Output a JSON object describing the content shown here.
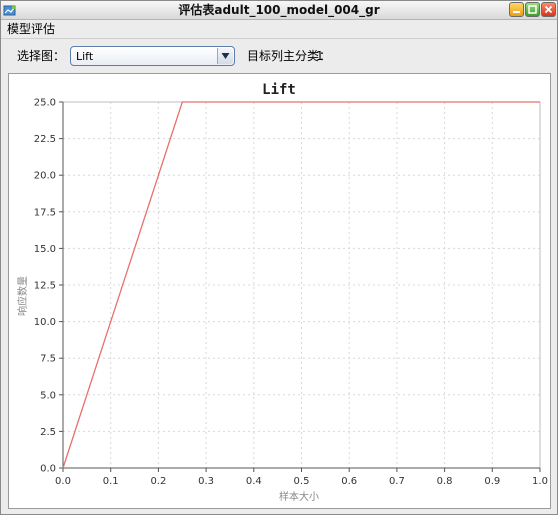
{
  "window": {
    "title": "评估表adult_100_model_004_gr",
    "icons": [
      "app-icon",
      "minimize-icon",
      "maximize-icon",
      "close-icon"
    ]
  },
  "menubar": {
    "items": [
      {
        "label": "模型评估"
      }
    ]
  },
  "toolbar": {
    "select_label": "选择图：",
    "select_value": "Lift",
    "target_label": "目标列主分类：",
    "target_value": "1"
  },
  "colors": {
    "line": "#e8706a",
    "grid": "#d8d8d8",
    "axis": "#555555",
    "select_border": "#5d7ea8"
  },
  "chart_data": {
    "type": "line",
    "title": "Lift",
    "xlabel": "样本大小",
    "ylabel": "响应数量",
    "xlim": [
      0.0,
      1.0
    ],
    "ylim": [
      0.0,
      25.0
    ],
    "x_ticks": [
      "0.0",
      "0.1",
      "0.2",
      "0.3",
      "0.4",
      "0.5",
      "0.6",
      "0.7",
      "0.8",
      "0.9",
      "1.0"
    ],
    "y_ticks": [
      "0.0",
      "2.5",
      "5.0",
      "7.5",
      "10.0",
      "12.5",
      "15.0",
      "17.5",
      "20.0",
      "22.5",
      "25.0"
    ],
    "grid": true,
    "legend": "none",
    "series": [
      {
        "x": [
          0.0,
          0.25,
          1.0
        ],
        "y": [
          0.0,
          25.0,
          25.0
        ]
      }
    ]
  }
}
